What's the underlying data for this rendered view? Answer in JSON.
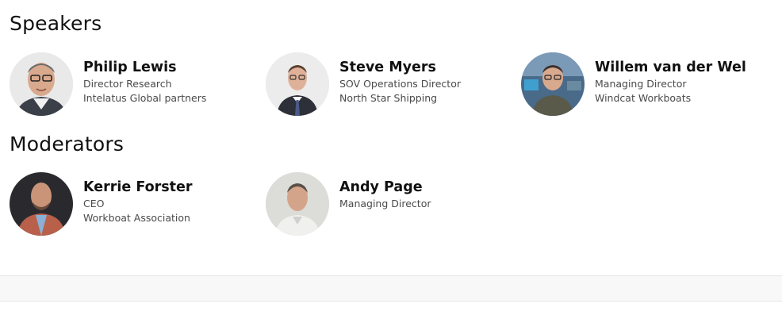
{
  "sections": {
    "speakers_title": "Speakers",
    "moderators_title": "Moderators"
  },
  "speakers": [
    {
      "name": "Philip Lewis",
      "title": "Director Research",
      "company": "Intelatus Global partners",
      "avatar": "portrait-photo-icon"
    },
    {
      "name": "Steve Myers",
      "title": "SOV Operations Director",
      "company": "North Star Shipping",
      "avatar": "portrait-photo-icon"
    },
    {
      "name": "Willem van der Wel",
      "title": "Managing Director",
      "company": "Windcat Workboats",
      "avatar": "portrait-photo-icon"
    }
  ],
  "moderators": [
    {
      "name": "Kerrie Forster",
      "title": "CEO",
      "company": "Workboat Association",
      "avatar": "portrait-photo-icon"
    },
    {
      "name": "Andy Page",
      "title": "Managing Director",
      "avatar": "portrait-photo-icon"
    }
  ]
}
